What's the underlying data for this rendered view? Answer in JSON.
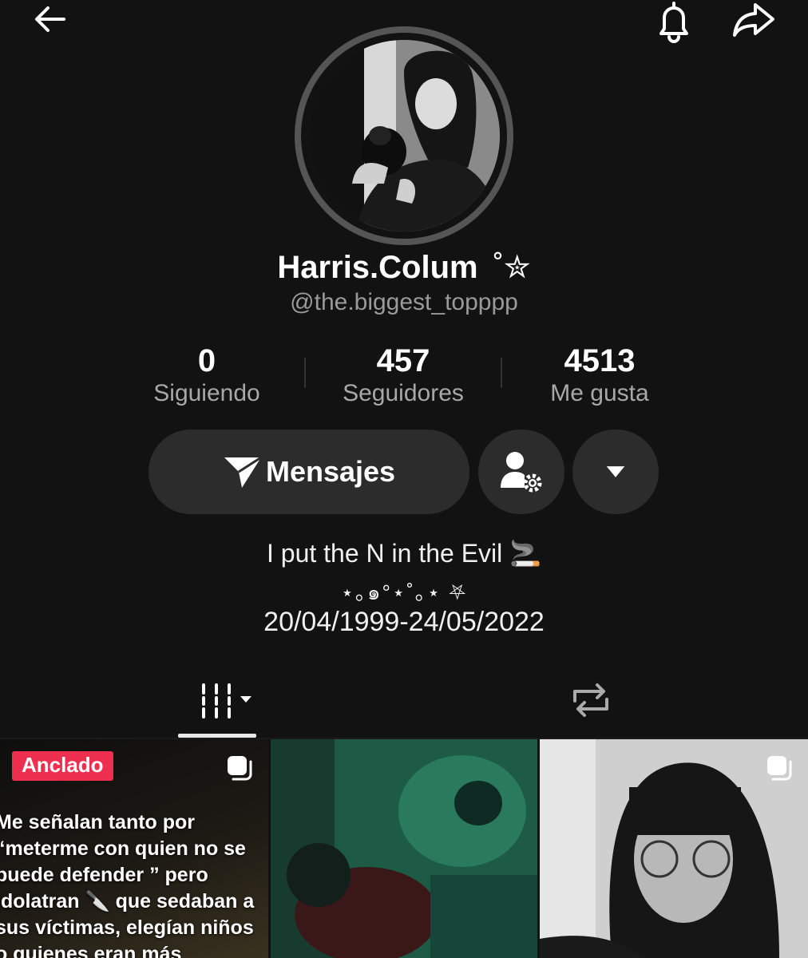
{
  "header": {
    "back_icon": "arrow-left-icon",
    "bell_icon": "bell-icon",
    "share_icon": "share-icon"
  },
  "profile": {
    "display_name": "Harris.Colum",
    "name_decoration": "˚✮",
    "handle": "@the.biggest_topppp"
  },
  "stats": [
    {
      "value": "0",
      "label": "Siguiendo"
    },
    {
      "value": "457",
      "label": "Seguidores"
    },
    {
      "value": "4513",
      "label": "Me gusta"
    }
  ],
  "actions": {
    "message_label": "Mensajes",
    "message_icon": "send-icon",
    "friend_settings_icon": "user-gear-icon",
    "dropdown_icon": "caret-down-icon"
  },
  "bio": {
    "line1": "I put the N in the Evil 🚬",
    "line2": "⋆｡๑°⋆˚｡⋆ ⛧",
    "line3": "20/04/1999-24/05/2022"
  },
  "tabs": {
    "videos_icon": "grid-icon",
    "reposts_icon": "repost-icon"
  },
  "posts": [
    {
      "pinned_label": "Anclado",
      "caption": "Me señalan tanto por “meterme con quien no se puede defender ” pero idolatran 🔪 que sedaban a sus víctimas, elegían niños o quienes eran más",
      "multi_icon": "photo-stack-icon"
    },
    {},
    {
      "multi_icon": "photo-stack-icon"
    }
  ],
  "colors": {
    "background": "#121212",
    "button_bg": "#2c2c2c",
    "pinned_badge": "#ee2f4f",
    "secondary_text": "#9a9a9a"
  }
}
